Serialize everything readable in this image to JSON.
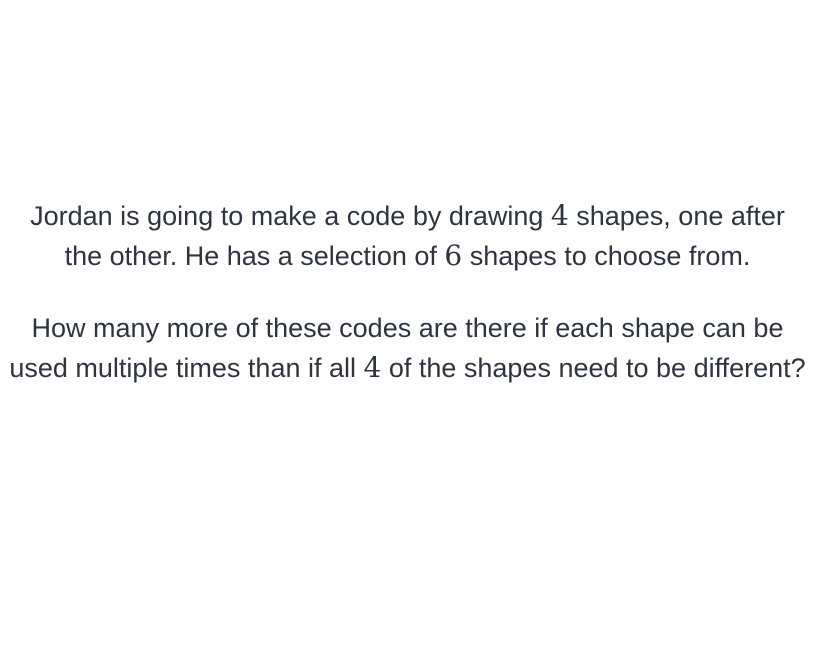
{
  "question": {
    "paragraph_1": {
      "text_before_n1": "Jordan is going to make a code by drawing ",
      "n1": "4",
      "text_after_n1": " shapes, one after the other. He has a selection of ",
      "n2": "6",
      "text_after_n2": " shapes to choose from."
    },
    "paragraph_2": {
      "text_before_n": "How many more of these codes are there if each shape can be used multiple times than if all ",
      "n": "4",
      "text_after_n": " of the shapes need to be different?"
    }
  }
}
